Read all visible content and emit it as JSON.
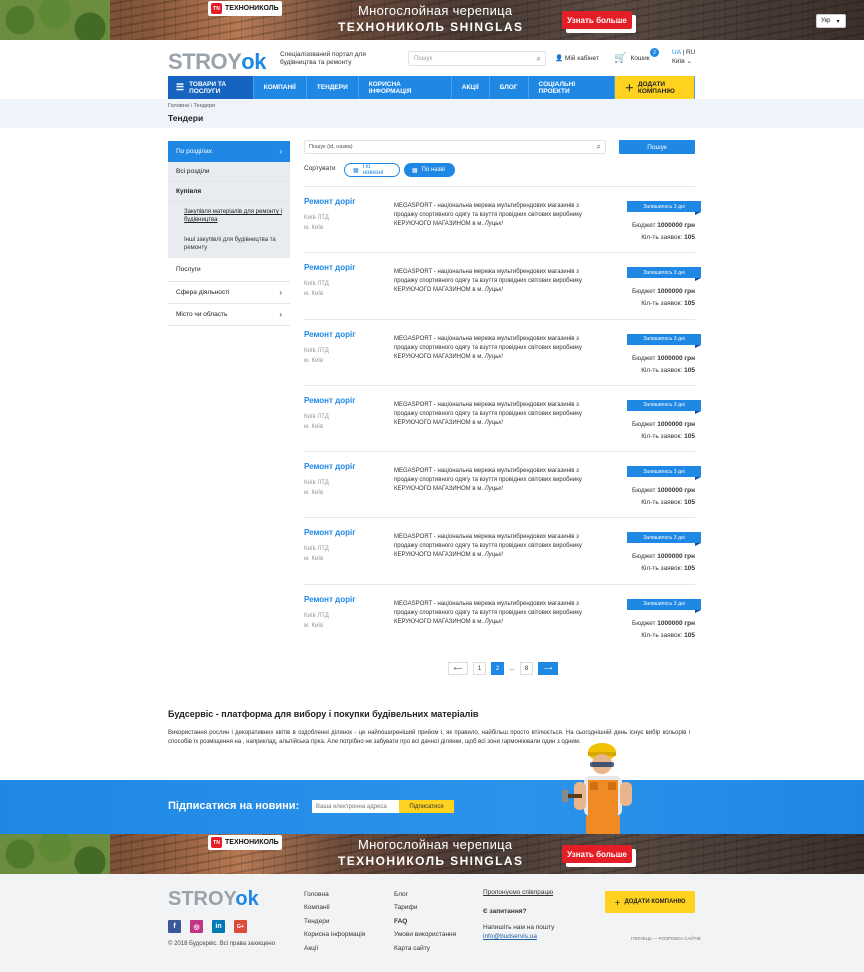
{
  "banner": {
    "brand": "ТЕХНОНИКОЛЬ",
    "brand_mark": "TN",
    "line1": "Многослойная черепица",
    "line2": "ТЕХНОНИКОЛЬ SHINGLAS",
    "button": "Узнать больше"
  },
  "header": {
    "brand_main": "STROY",
    "brand_ok": "ok",
    "tagline": "Спеціалізований портал для будівництва та ремонту",
    "search_placeholder": "Пошук",
    "cabinet": "Мій кабінет",
    "cart": "Кошик",
    "cart_count": "2",
    "lang_ua": "UA",
    "lang_ru": "RU",
    "city": "Київ",
    "lang_select": "Укр"
  },
  "nav": {
    "items": [
      "ТОВАРИ ТА ПОСЛУГИ",
      "КОМПАНІЇ",
      "ТЕНДЕРИ",
      "КОРИСНА ІНФОРМАЦІЯ",
      "АКЦІЇ",
      "БЛОГ",
      "СОЦІАЛЬНІ ПРОЕКТИ"
    ],
    "add_company": "ДОДАТИ КОМПАНІЮ"
  },
  "breadcrumb": "Головна \\ Тендери",
  "page_title": "Тендери",
  "sidebar": {
    "head": "По розділах",
    "all": "Всі розділи",
    "group": "Купівля",
    "sub1": "Закупівля матеріалів для ремонту і будівництва",
    "sub2": "Інші закупівлі для будівництва та ремонту",
    "services": "Послуги",
    "sphere": "Сфера діяльності",
    "city": "Місто чи область"
  },
  "search": {
    "placeholder": "Пошук (id, назва)",
    "button": "Пошук"
  },
  "sort": {
    "label": "Сортувати",
    "newest": "По новизні",
    "name": "По назві"
  },
  "tenders": [
    {
      "title": "Ремонт доріг",
      "company": "Київ ЛТД",
      "city": "м. Київ",
      "desc": "MEGASPORT - національна мережа мультибрендових магазинів з продажу спортивного одягу та взуття провідних світових виробнику КЕРУЮЧОГО МАГАЗИНОМ в м. ",
      "desc_city": "Луцьк!",
      "left": "Залишилось 3 дні",
      "budget_label": "Бюджет",
      "budget": "1000000 грн",
      "count_label": "Кіл-ть заявок:",
      "count": "105"
    },
    {
      "title": "Ремонт доріг",
      "company": "Київ ЛТД",
      "city": "м. Київ",
      "desc": "MEGASPORT - національна мережа мультибрендових магазинів з продажу спортивного одягу та взуття провідних світових виробнику КЕРУЮЧОГО МАГАЗИНОМ в м. ",
      "desc_city": "Луцьк!",
      "left": "Залишилось 3 дні",
      "budget_label": "Бюджет",
      "budget": "1000000 грн",
      "count_label": "Кіл-ть заявок:",
      "count": "105"
    },
    {
      "title": "Ремонт доріг",
      "company": "Київ ЛТД",
      "city": "м. Київ",
      "desc": "MEGASPORT - національна мережа мультибрендових магазинів з продажу спортивного одягу та взуття провідних світових виробнику КЕРУЮЧОГО МАГАЗИНОМ в м. ",
      "desc_city": "Луцьк!",
      "left": "Залишилось 3 дні",
      "budget_label": "Бюджет",
      "budget": "1000000 грн",
      "count_label": "Кіл-ть заявок:",
      "count": "105"
    },
    {
      "title": "Ремонт доріг",
      "company": "Київ ЛТД",
      "city": "м. Київ",
      "desc": "MEGASPORT - національна мережа мультибрендових магазинів з продажу спортивного одягу та взуття провідних світових виробнику КЕРУЮЧОГО МАГАЗИНОМ в м. ",
      "desc_city": "Луцьк!",
      "left": "Залишилось 3 дні",
      "budget_label": "Бюджет",
      "budget": "1000000 грн",
      "count_label": "Кіл-ть заявок:",
      "count": "105"
    },
    {
      "title": "Ремонт доріг",
      "company": "Київ ЛТД",
      "city": "м. Київ",
      "desc": "MEGASPORT - національна мережа мультибрендових магазинів з продажу спортивного одягу та взуття провідних світових виробнику КЕРУЮЧОГО МАГАЗИНОМ в м. ",
      "desc_city": "Луцьк!",
      "left": "Залишилось 3 дні",
      "budget_label": "Бюджет",
      "budget": "1000000 грн",
      "count_label": "Кіл-ть заявок:",
      "count": "105"
    },
    {
      "title": "Ремонт доріг",
      "company": "Київ ЛТД",
      "city": "м. Київ",
      "desc": "MEGASPORT - національна мережа мультибрендових магазинів з продажу спортивного одягу та взуття провідних світових виробнику КЕРУЮЧОГО МАГАЗИНОМ в м. ",
      "desc_city": "Луцьк!",
      "left": "Залишилось 3 дні",
      "budget_label": "Бюджет",
      "budget": "1000000 грн",
      "count_label": "Кіл-ть заявок:",
      "count": "105"
    },
    {
      "title": "Ремонт доріг",
      "company": "Київ ЛТД",
      "city": "м. Київ",
      "desc": "MEGASPORT - національна мережа мультибрендових магазинів з продажу спортивного одягу та взуття провідних світових виробнику КЕРУЮЧОГО МАГАЗИНОМ в м. ",
      "desc_city": "Луцьк!",
      "left": "Залишилось 3 дні",
      "budget_label": "Бюджет",
      "budget": "1000000 грн",
      "count_label": "Кіл-ть заявок:",
      "count": "105"
    }
  ],
  "pager": {
    "pages": [
      "1",
      "2",
      "...",
      "8"
    ],
    "current": "2"
  },
  "about": {
    "title": "Будсервіс - платформа для вибору і покупки будівельних матеріалів",
    "text": "Використання рослин і декоративних квітів в оздобленні ділянок - це найпоширеніший прийом і, як правило, найбільш просто втілюється. На сьогоднішній день існує вибір кольорів і способів їх розміщення на , наприклад, альпійська гірка. Але потрібно не забувати про всі дачної ділянки, щоб всі зони гармоніювали один з одним."
  },
  "subscribe": {
    "label": "Підписатися на новини:",
    "placeholder": "Ваша електронна адреса",
    "button": "Підписатися"
  },
  "footer": {
    "copyright": "© 2018 Будсервіс. Всі права захищено",
    "col1": [
      "Головна",
      "Компанії",
      "Тендери",
      "Корисна інформація",
      "Акції"
    ],
    "col2": [
      "Блог",
      "Тарифи",
      "FAQ",
      "Умови використання",
      "Карта сайту"
    ],
    "coop": "Пропонуємо співпрацю",
    "question": "Є запитання?",
    "write": "Напишіть нам на пошту",
    "email": "info@budservis.ua",
    "add_company": "ДОДАТИ КОМПАНІЮ",
    "dev": "ГЛИНЕЦЬ — РОЗРОБКА САЙТІВ",
    "social": [
      "f",
      "◎",
      "in",
      "G+"
    ]
  },
  "colors": {
    "accent": "#1f88e5",
    "yellow": "#ffd21f",
    "red": "#e41e26"
  }
}
